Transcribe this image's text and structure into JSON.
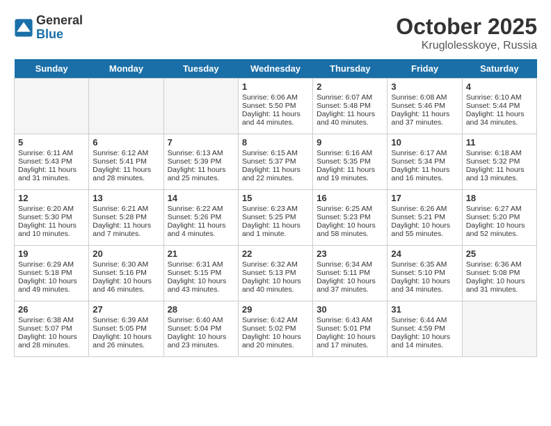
{
  "header": {
    "logo_line1": "General",
    "logo_line2": "Blue",
    "month": "October 2025",
    "location": "Kruglolesskoye, Russia"
  },
  "days_of_week": [
    "Sunday",
    "Monday",
    "Tuesday",
    "Wednesday",
    "Thursday",
    "Friday",
    "Saturday"
  ],
  "weeks": [
    [
      {
        "day": "",
        "info": ""
      },
      {
        "day": "",
        "info": ""
      },
      {
        "day": "",
        "info": ""
      },
      {
        "day": "1",
        "info": "Sunrise: 6:06 AM\nSunset: 5:50 PM\nDaylight: 11 hours and 44 minutes."
      },
      {
        "day": "2",
        "info": "Sunrise: 6:07 AM\nSunset: 5:48 PM\nDaylight: 11 hours and 40 minutes."
      },
      {
        "day": "3",
        "info": "Sunrise: 6:08 AM\nSunset: 5:46 PM\nDaylight: 11 hours and 37 minutes."
      },
      {
        "day": "4",
        "info": "Sunrise: 6:10 AM\nSunset: 5:44 PM\nDaylight: 11 hours and 34 minutes."
      }
    ],
    [
      {
        "day": "5",
        "info": "Sunrise: 6:11 AM\nSunset: 5:43 PM\nDaylight: 11 hours and 31 minutes."
      },
      {
        "day": "6",
        "info": "Sunrise: 6:12 AM\nSunset: 5:41 PM\nDaylight: 11 hours and 28 minutes."
      },
      {
        "day": "7",
        "info": "Sunrise: 6:13 AM\nSunset: 5:39 PM\nDaylight: 11 hours and 25 minutes."
      },
      {
        "day": "8",
        "info": "Sunrise: 6:15 AM\nSunset: 5:37 PM\nDaylight: 11 hours and 22 minutes."
      },
      {
        "day": "9",
        "info": "Sunrise: 6:16 AM\nSunset: 5:35 PM\nDaylight: 11 hours and 19 minutes."
      },
      {
        "day": "10",
        "info": "Sunrise: 6:17 AM\nSunset: 5:34 PM\nDaylight: 11 hours and 16 minutes."
      },
      {
        "day": "11",
        "info": "Sunrise: 6:18 AM\nSunset: 5:32 PM\nDaylight: 11 hours and 13 minutes."
      }
    ],
    [
      {
        "day": "12",
        "info": "Sunrise: 6:20 AM\nSunset: 5:30 PM\nDaylight: 11 hours and 10 minutes."
      },
      {
        "day": "13",
        "info": "Sunrise: 6:21 AM\nSunset: 5:28 PM\nDaylight: 11 hours and 7 minutes."
      },
      {
        "day": "14",
        "info": "Sunrise: 6:22 AM\nSunset: 5:26 PM\nDaylight: 11 hours and 4 minutes."
      },
      {
        "day": "15",
        "info": "Sunrise: 6:23 AM\nSunset: 5:25 PM\nDaylight: 11 hours and 1 minute."
      },
      {
        "day": "16",
        "info": "Sunrise: 6:25 AM\nSunset: 5:23 PM\nDaylight: 10 hours and 58 minutes."
      },
      {
        "day": "17",
        "info": "Sunrise: 6:26 AM\nSunset: 5:21 PM\nDaylight: 10 hours and 55 minutes."
      },
      {
        "day": "18",
        "info": "Sunrise: 6:27 AM\nSunset: 5:20 PM\nDaylight: 10 hours and 52 minutes."
      }
    ],
    [
      {
        "day": "19",
        "info": "Sunrise: 6:29 AM\nSunset: 5:18 PM\nDaylight: 10 hours and 49 minutes."
      },
      {
        "day": "20",
        "info": "Sunrise: 6:30 AM\nSunset: 5:16 PM\nDaylight: 10 hours and 46 minutes."
      },
      {
        "day": "21",
        "info": "Sunrise: 6:31 AM\nSunset: 5:15 PM\nDaylight: 10 hours and 43 minutes."
      },
      {
        "day": "22",
        "info": "Sunrise: 6:32 AM\nSunset: 5:13 PM\nDaylight: 10 hours and 40 minutes."
      },
      {
        "day": "23",
        "info": "Sunrise: 6:34 AM\nSunset: 5:11 PM\nDaylight: 10 hours and 37 minutes."
      },
      {
        "day": "24",
        "info": "Sunrise: 6:35 AM\nSunset: 5:10 PM\nDaylight: 10 hours and 34 minutes."
      },
      {
        "day": "25",
        "info": "Sunrise: 6:36 AM\nSunset: 5:08 PM\nDaylight: 10 hours and 31 minutes."
      }
    ],
    [
      {
        "day": "26",
        "info": "Sunrise: 6:38 AM\nSunset: 5:07 PM\nDaylight: 10 hours and 28 minutes."
      },
      {
        "day": "27",
        "info": "Sunrise: 6:39 AM\nSunset: 5:05 PM\nDaylight: 10 hours and 26 minutes."
      },
      {
        "day": "28",
        "info": "Sunrise: 6:40 AM\nSunset: 5:04 PM\nDaylight: 10 hours and 23 minutes."
      },
      {
        "day": "29",
        "info": "Sunrise: 6:42 AM\nSunset: 5:02 PM\nDaylight: 10 hours and 20 minutes."
      },
      {
        "day": "30",
        "info": "Sunrise: 6:43 AM\nSunset: 5:01 PM\nDaylight: 10 hours and 17 minutes."
      },
      {
        "day": "31",
        "info": "Sunrise: 6:44 AM\nSunset: 4:59 PM\nDaylight: 10 hours and 14 minutes."
      },
      {
        "day": "",
        "info": ""
      }
    ]
  ]
}
